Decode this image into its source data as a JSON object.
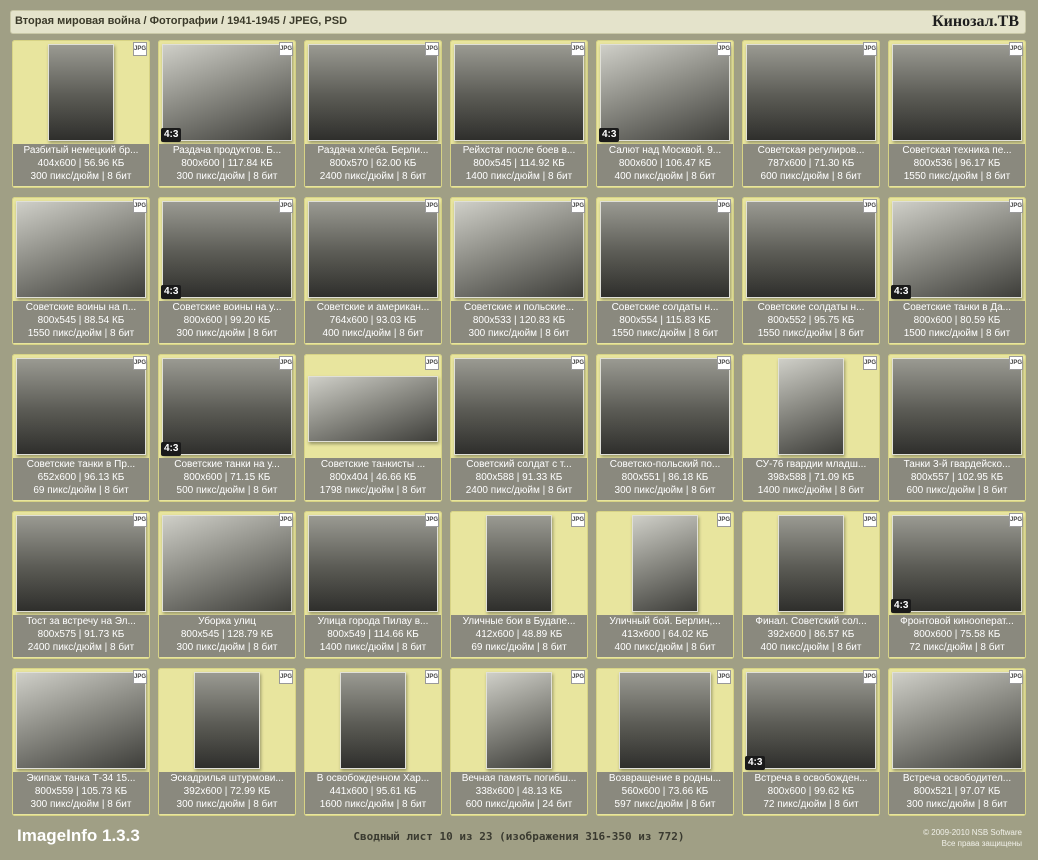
{
  "header": {
    "path": "Вторая мировая война / Фотографии / 1941-1945 / JPEG, PSD",
    "brand": "Кинозал.ТВ"
  },
  "badge_label": "JPG",
  "ratio_label": "4:3",
  "tiles": [
    {
      "title": "Разбитый немецкий бр...",
      "dims": "404x600 | 56.96 КБ",
      "res": "300 пикс/дюйм | 8 бит",
      "ratio": false,
      "shape": "portrait"
    },
    {
      "title": "Раздача продуктов. Б...",
      "dims": "800x600 | 117.84 КБ",
      "res": "300 пикс/дюйм | 8 бит",
      "ratio": true,
      "shape": "wide"
    },
    {
      "title": "Раздача хлеба. Берли...",
      "dims": "800x570 | 62.00 КБ",
      "res": "2400 пикс/дюйм | 8 бит",
      "ratio": false,
      "shape": "wide"
    },
    {
      "title": "Рейхстаг после боев в...",
      "dims": "800x545 | 114.92 КБ",
      "res": "1400 пикс/дюйм | 8 бит",
      "ratio": false,
      "shape": "wide"
    },
    {
      "title": "Салют над Москвой. 9...",
      "dims": "800x600 | 106.47 КБ",
      "res": "400 пикс/дюйм | 8 бит",
      "ratio": true,
      "shape": "wide"
    },
    {
      "title": "Советская регулиров...",
      "dims": "787x600 | 71.30 КБ",
      "res": "600 пикс/дюйм | 8 бит",
      "ratio": false,
      "shape": "wide"
    },
    {
      "title": "Советская техника пе...",
      "dims": "800x536 | 96.17 КБ",
      "res": "1550 пикс/дюйм | 8 бит",
      "ratio": false,
      "shape": "wide"
    },
    {
      "title": "Советские воины на п...",
      "dims": "800x545 | 88.54 КБ",
      "res": "1550 пикс/дюйм | 8 бит",
      "ratio": false,
      "shape": "wide"
    },
    {
      "title": "Советские воины на у...",
      "dims": "800x600 | 99.20 КБ",
      "res": "300 пикс/дюйм | 8 бит",
      "ratio": true,
      "shape": "wide"
    },
    {
      "title": "Советские и американ...",
      "dims": "764x600 | 93.03 КБ",
      "res": "400 пикс/дюйм | 8 бит",
      "ratio": false,
      "shape": "wide"
    },
    {
      "title": "Советские и польские...",
      "dims": "800x533 | 120.83 КБ",
      "res": "300 пикс/дюйм | 8 бит",
      "ratio": false,
      "shape": "wide"
    },
    {
      "title": "Советские солдаты н...",
      "dims": "800x554 | 115.83 КБ",
      "res": "1550 пикс/дюйм | 8 бит",
      "ratio": false,
      "shape": "wide"
    },
    {
      "title": "Советские солдаты н...",
      "dims": "800x552 | 95.75 КБ",
      "res": "1550 пикс/дюйм | 8 бит",
      "ratio": false,
      "shape": "wide"
    },
    {
      "title": "Советские танки в Да...",
      "dims": "800x600 | 80.59 КБ",
      "res": "1500 пикс/дюйм | 8 бит",
      "ratio": true,
      "shape": "wide"
    },
    {
      "title": "Советские танки в Пр...",
      "dims": "652x600 | 96.13 КБ",
      "res": "69 пикс/дюйм | 8 бит",
      "ratio": false,
      "shape": "wide"
    },
    {
      "title": "Советские танки на у...",
      "dims": "800x600 | 71.15 КБ",
      "res": "500 пикс/дюйм | 8 бит",
      "ratio": true,
      "shape": "wide"
    },
    {
      "title": "Советские танкисты ...",
      "dims": "800x404 | 46.66 КБ",
      "res": "1798 пикс/дюйм | 8 бит",
      "ratio": false,
      "shape": "flat"
    },
    {
      "title": "Советский солдат с т...",
      "dims": "800x588 | 91.33 КБ",
      "res": "2400 пикс/дюйм | 8 бит",
      "ratio": false,
      "shape": "wide"
    },
    {
      "title": "Советско-польский по...",
      "dims": "800x551 | 86.18 КБ",
      "res": "300 пикс/дюйм | 8 бит",
      "ratio": false,
      "shape": "wide"
    },
    {
      "title": "СУ-76 гвардии младш...",
      "dims": "398x588 | 71.09 КБ",
      "res": "1400 пикс/дюйм | 8 бит",
      "ratio": false,
      "shape": "portrait"
    },
    {
      "title": "Танки 3-й гвардейско...",
      "dims": "800x557 | 102.95 КБ",
      "res": "600 пикс/дюйм | 8 бит",
      "ratio": false,
      "shape": "wide"
    },
    {
      "title": "Тост за встречу на Эл...",
      "dims": "800x575 | 91.73 КБ",
      "res": "2400 пикс/дюйм | 8 бит",
      "ratio": false,
      "shape": "wide"
    },
    {
      "title": "Уборка улиц",
      "dims": "800x545 | 128.79 КБ",
      "res": "300 пикс/дюйм | 8 бит",
      "ratio": false,
      "shape": "wide"
    },
    {
      "title": "Улица города Пилау в...",
      "dims": "800x549 | 114.66 КБ",
      "res": "1400 пикс/дюйм | 8 бит",
      "ratio": false,
      "shape": "wide"
    },
    {
      "title": "Уличные бои в Будапе...",
      "dims": "412x600 | 48.89 КБ",
      "res": "69 пикс/дюйм | 8 бит",
      "ratio": false,
      "shape": "portrait"
    },
    {
      "title": "Уличный бой. Берлин,...",
      "dims": "413x600 | 64.02 КБ",
      "res": "400 пикс/дюйм | 8 бит",
      "ratio": false,
      "shape": "portrait"
    },
    {
      "title": "Финал. Советский сол...",
      "dims": "392x600 | 86.57 КБ",
      "res": "400 пикс/дюйм | 8 бит",
      "ratio": false,
      "shape": "portrait"
    },
    {
      "title": "Фронтовой кинооперат...",
      "dims": "800x600 | 75.58 КБ",
      "res": "72 пикс/дюйм | 8 бит",
      "ratio": true,
      "shape": "wide"
    },
    {
      "title": "Экипаж танка Т-34 15...",
      "dims": "800x559 | 105.73 КБ",
      "res": "300 пикс/дюйм | 8 бит",
      "ratio": false,
      "shape": "wide"
    },
    {
      "title": "Эскадрилья штурмови...",
      "dims": "392x600 | 72.99 КБ",
      "res": "300 пикс/дюйм | 8 бит",
      "ratio": false,
      "shape": "portrait"
    },
    {
      "title": "В освобожденном Хар...",
      "dims": "441x600 | 95.61 КБ",
      "res": "1600 пикс/дюйм | 8 бит",
      "ratio": false,
      "shape": "portrait"
    },
    {
      "title": "Вечная память погибш...",
      "dims": "338x600 | 48.13 КБ",
      "res": "600 пикс/дюйм | 24 бит",
      "ratio": false,
      "shape": "portrait"
    },
    {
      "title": "Возвращение в родны...",
      "dims": "560x600 | 73.66 КБ",
      "res": "597 пикс/дюйм | 8 бит",
      "ratio": false,
      "shape": "medium"
    },
    {
      "title": "Встреча в освобожден...",
      "dims": "800x600 | 99.62 КБ",
      "res": "72 пикс/дюйм | 8 бит",
      "ratio": true,
      "shape": "wide"
    },
    {
      "title": "Встреча освободител...",
      "dims": "800x521 | 97.07 КБ",
      "res": "300 пикс/дюйм | 8 бит",
      "ratio": false,
      "shape": "wide"
    }
  ],
  "footer": {
    "app": "ImageInfo 1.3.3",
    "summary": "Сводный лист 10 из 23 (изображения 316-350 из 772)",
    "copyright_line1": "© 2009-2010 NSB Software",
    "copyright_line2": "Все права защищены"
  }
}
